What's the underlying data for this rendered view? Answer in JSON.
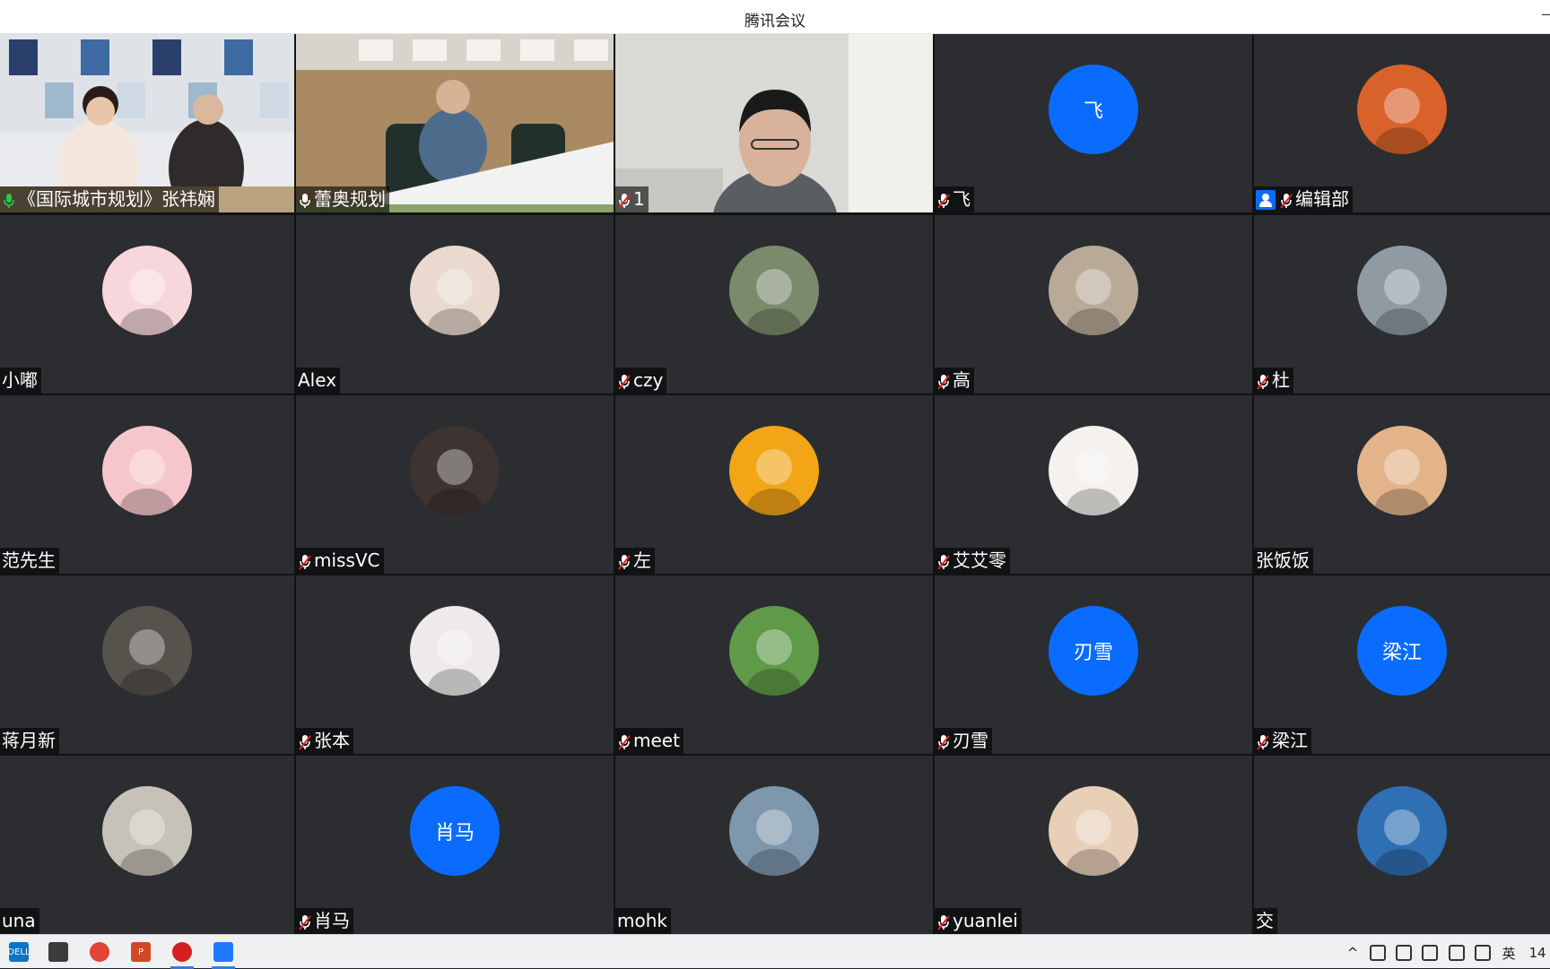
{
  "window": {
    "title": "腾讯会议"
  },
  "tiles": [
    {
      "name": "《国际城市规划》张祎娴",
      "mic": "on",
      "kind": "video",
      "scene": "office"
    },
    {
      "name": "蕾奥规划",
      "mic": "on-white",
      "kind": "video",
      "scene": "meeting"
    },
    {
      "name": "1",
      "mic": "muted",
      "kind": "video",
      "scene": "home"
    },
    {
      "name": "飞",
      "mic": "muted",
      "kind": "text-avatar",
      "avatar_text": "飞"
    },
    {
      "name": "编辑部",
      "mic": "muted",
      "host": true,
      "kind": "image-avatar",
      "avatar": "cat-icon",
      "color": "#d9622a"
    },
    {
      "name": "小嘟",
      "mic": "none",
      "kind": "image-avatar",
      "avatar": "cartoon-bunny-icon",
      "color": "#f7d7dc"
    },
    {
      "name": "Alex",
      "mic": "none",
      "kind": "image-avatar",
      "avatar": "painting-icon",
      "color": "#e9d9cf"
    },
    {
      "name": "czy",
      "mic": "muted",
      "kind": "image-avatar",
      "avatar": "landscape-icon",
      "color": "#7c8a6c"
    },
    {
      "name": "高",
      "mic": "muted",
      "kind": "image-avatar",
      "avatar": "dog-icon",
      "color": "#b9aa98"
    },
    {
      "name": "杜",
      "mic": "muted",
      "kind": "image-avatar",
      "avatar": "person-photo-icon",
      "color": "#8f9aa3"
    },
    {
      "name": "范先生",
      "mic": "none",
      "kind": "image-avatar",
      "avatar": "cartoon-girl-icon",
      "color": "#f5c6cb"
    },
    {
      "name": "missVC",
      "mic": "muted",
      "kind": "image-avatar",
      "avatar": "woman-photo-icon",
      "color": "#3d3431"
    },
    {
      "name": "左",
      "mic": "muted",
      "kind": "image-avatar",
      "avatar": "smiley-icon",
      "color": "#f2a516"
    },
    {
      "name": "艾艾零",
      "mic": "muted",
      "kind": "image-avatar",
      "avatar": "pig-icon",
      "color": "#f4f1ee"
    },
    {
      "name": "张饭饭",
      "mic": "none",
      "kind": "image-avatar",
      "avatar": "cat-photo-icon",
      "color": "#e3b48a"
    },
    {
      "name": "蒋月新",
      "mic": "none",
      "kind": "image-avatar",
      "avatar": "man-photo-icon",
      "color": "#56524c"
    },
    {
      "name": "张本",
      "mic": "muted",
      "kind": "image-avatar",
      "avatar": "sketch-icon",
      "color": "#eeeaea"
    },
    {
      "name": "meet",
      "mic": "muted",
      "kind": "image-avatar",
      "avatar": "grassland-icon",
      "color": "#5f9a48"
    },
    {
      "name": "刃雪",
      "mic": "muted",
      "kind": "text-avatar",
      "avatar_text": "刃雪"
    },
    {
      "name": "梁江",
      "mic": "muted",
      "kind": "text-avatar",
      "avatar_text": "梁江"
    },
    {
      "name": "una",
      "mic": "none",
      "kind": "image-avatar",
      "avatar": "rabbit-icon",
      "color": "#c7c2b8"
    },
    {
      "name": "肖马",
      "mic": "muted",
      "kind": "text-avatar",
      "avatar_text": "肖马"
    },
    {
      "name": "mohk",
      "mic": "none",
      "kind": "image-avatar",
      "avatar": "town-photo-icon",
      "color": "#7e97ad"
    },
    {
      "name": "yuanlei",
      "mic": "muted",
      "kind": "image-avatar",
      "avatar": "tiger-icon",
      "color": "#e8cfb8"
    },
    {
      "name": "交",
      "mic": "none",
      "kind": "image-avatar",
      "avatar": "desert-photo-icon",
      "color": "#2f6fb3"
    }
  ],
  "taskbar": {
    "apps": [
      {
        "icon": "dell-icon",
        "color": "#0a74c5",
        "label": "DELL"
      },
      {
        "icon": "calculator-icon",
        "color": "#3b3b3b"
      },
      {
        "icon": "chrome-icon",
        "color": "#e24335"
      },
      {
        "icon": "powerpoint-icon",
        "color": "#d24726",
        "label": "P"
      },
      {
        "icon": "record-icon",
        "color": "#d61f1f"
      },
      {
        "icon": "tencent-meeting-icon",
        "color": "#1e7bff"
      }
    ],
    "tray": [
      {
        "icon": "chevron-up-icon",
        "glyph": "^"
      },
      {
        "icon": "microphone-icon",
        "glyph": ""
      },
      {
        "icon": "wechat-icon",
        "glyph": ""
      },
      {
        "icon": "battery-icon",
        "glyph": ""
      },
      {
        "icon": "network-icon",
        "glyph": ""
      },
      {
        "icon": "volume-icon",
        "glyph": ""
      },
      {
        "icon": "ime-icon",
        "glyph": "英"
      },
      {
        "icon": "clock",
        "glyph": "14"
      }
    ]
  },
  "colors": {
    "muted_mic": "#e02020",
    "active_mic": "#26c94a",
    "avatar_blue": "#0a6cff"
  }
}
